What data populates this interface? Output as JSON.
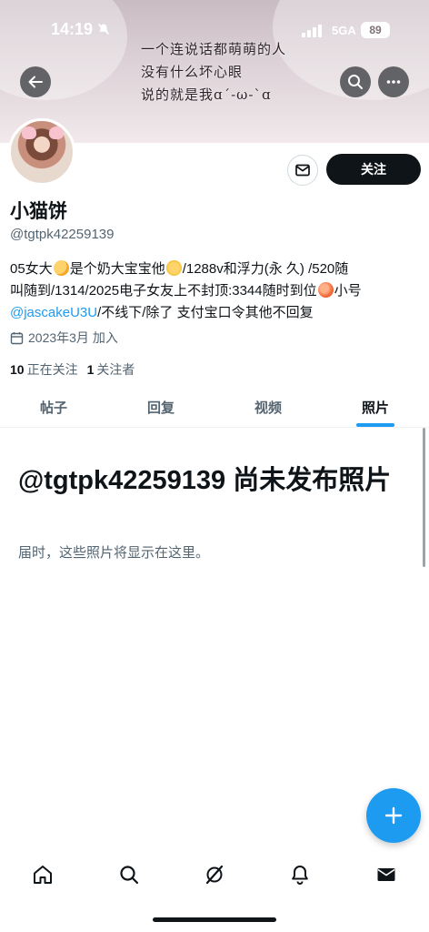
{
  "status_bar": {
    "time": "14:19",
    "network": "5GA",
    "battery": "89"
  },
  "banner": {
    "lines": [
      "一个连说话都萌萌的人",
      "没有什么坏心眼",
      "说的就是我ɑ´-ω-`ɑ"
    ]
  },
  "header": {
    "back_icon": "arrow-left-icon",
    "search_icon": "search-icon",
    "more_icon": "more-horizontal-icon"
  },
  "profile": {
    "display_name": "小猫饼",
    "handle": "@tgtpk42259139",
    "bio": {
      "l1_a": "05女大",
      "l1_b": "是个奶大宝宝他",
      "l1_c": "/1288v和浮力(永 久) /520随",
      "l2_a": "叫随到/1314/2025电子女友上不封顶:3344随时到位",
      "l2_b": "小号",
      "l3_link": "@jascakeU3U",
      "l3_rest": "/不线下/除了 支付宝口令其他不回复"
    },
    "joined": "2023年3月 加入",
    "following_count": "10",
    "following_label": "正在关注",
    "followers_count": "1",
    "followers_label": "关注者"
  },
  "actions": {
    "follow_label": "关注"
  },
  "tabs": [
    {
      "label": "帖子",
      "active": false
    },
    {
      "label": "回复",
      "active": false
    },
    {
      "label": "视频",
      "active": false
    },
    {
      "label": "照片",
      "active": true
    }
  ],
  "empty_state": {
    "title": "@tgtpk42259139 尚未发布照片",
    "subtitle": "届时，这些照片将显示在这里。"
  },
  "colors": {
    "accent": "#1d9bf0",
    "text": "#0f1419",
    "secondary": "#536471"
  },
  "bottom_nav": [
    "home-icon",
    "search-icon",
    "grok-icon",
    "notifications-icon",
    "messages-icon"
  ]
}
